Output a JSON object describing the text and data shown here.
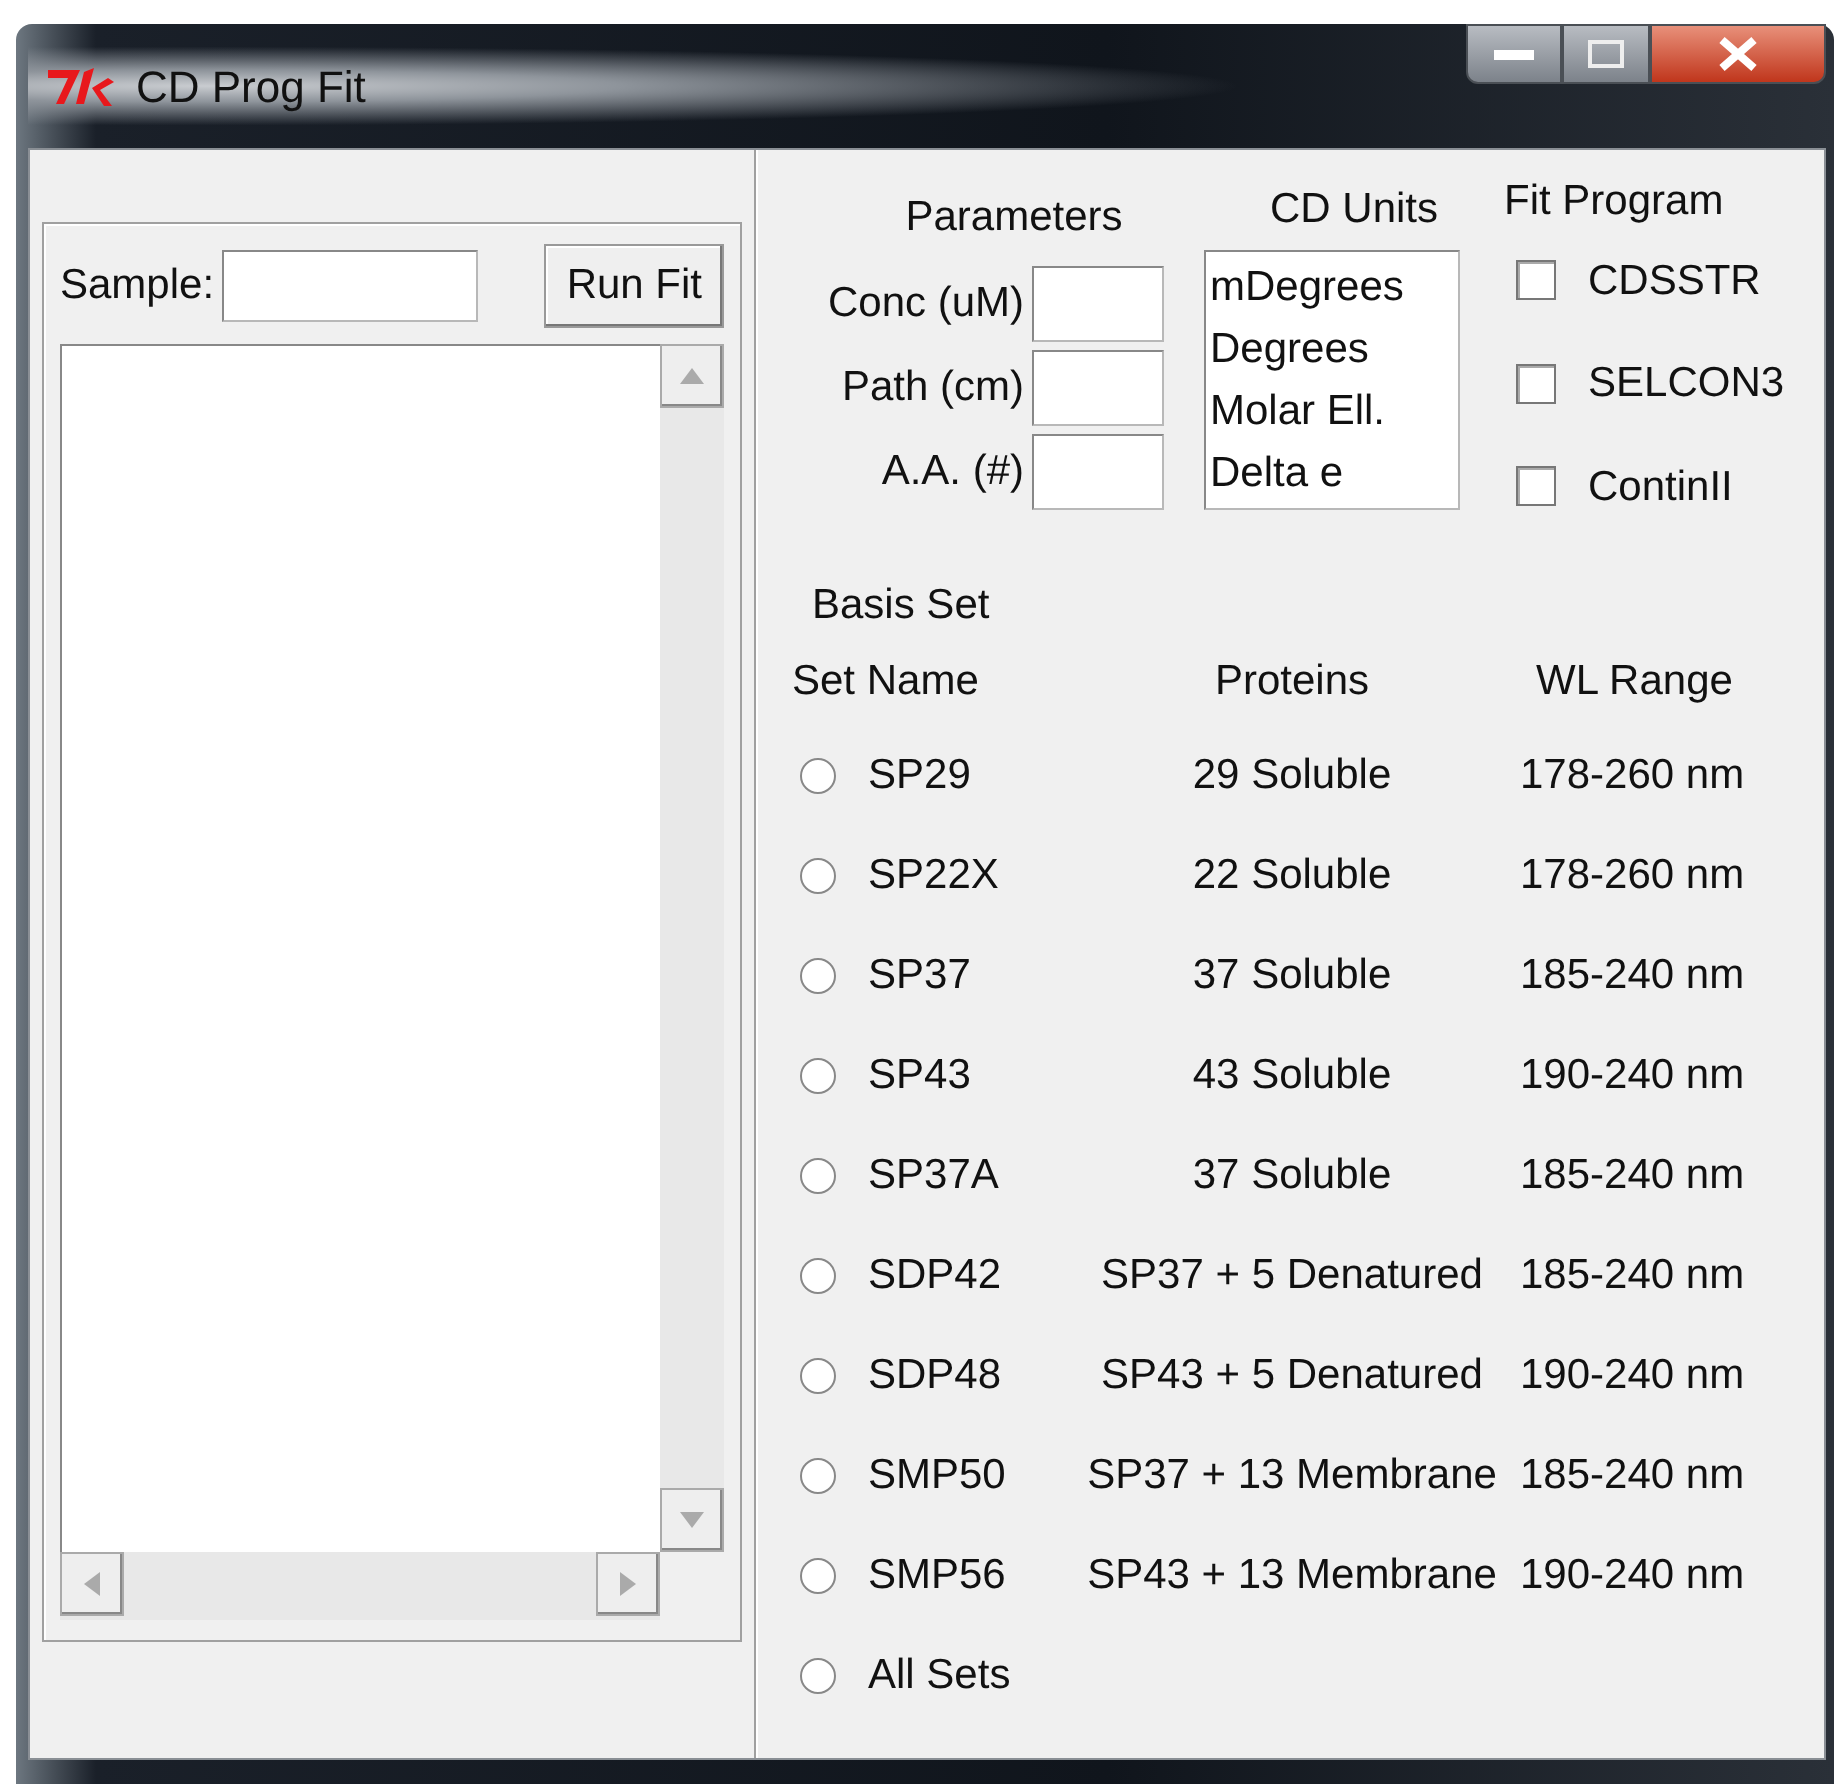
{
  "window": {
    "title": "CD Prog Fit"
  },
  "sample": {
    "label": "Sample:"
  },
  "run_button": "Run Fit",
  "parameters": {
    "title": "Parameters",
    "fields": [
      {
        "label": "Conc (uM)"
      },
      {
        "label": "Path (cm)"
      },
      {
        "label": "A.A. (#)"
      }
    ]
  },
  "cd_units": {
    "title": "CD Units",
    "options": [
      {
        "label": "mDegrees",
        "selected": false
      },
      {
        "label": "Degrees",
        "selected": false
      },
      {
        "label": "Molar Ell.",
        "selected": false
      },
      {
        "label": "Delta e",
        "selected": false
      }
    ]
  },
  "fit_program": {
    "title": "Fit Program",
    "options": [
      {
        "label": "CDSSTR",
        "checked": false
      },
      {
        "label": "SELCON3",
        "checked": false
      },
      {
        "label": "ContinII",
        "checked": false
      }
    ]
  },
  "basis_set": {
    "title": "Basis Set",
    "columns": [
      "Set Name",
      "Proteins",
      "WL Range"
    ],
    "rows": [
      {
        "name": "SP29",
        "proteins": "29 Soluble",
        "wl_range": "178-260 nm",
        "selected": false
      },
      {
        "name": "SP22X",
        "proteins": "22 Soluble",
        "wl_range": "178-260 nm",
        "selected": false
      },
      {
        "name": "SP37",
        "proteins": "37 Soluble",
        "wl_range": "185-240 nm",
        "selected": false
      },
      {
        "name": "SP43",
        "proteins": "43 Soluble",
        "wl_range": "190-240 nm",
        "selected": false
      },
      {
        "name": "SP37A",
        "proteins": "37 Soluble",
        "wl_range": "185-240 nm",
        "selected": false
      },
      {
        "name": "SDP42",
        "proteins": "SP37 + 5 Denatured",
        "wl_range": "185-240 nm",
        "selected": false
      },
      {
        "name": "SDP48",
        "proteins": "SP43 + 5 Denatured",
        "wl_range": "190-240 nm",
        "selected": false
      },
      {
        "name": "SMP50",
        "proteins": "SP37 + 13 Membrane",
        "wl_range": "185-240 nm",
        "selected": false
      },
      {
        "name": "SMP56",
        "proteins": "SP43 + 13 Membrane",
        "wl_range": "190-240 nm",
        "selected": false
      },
      {
        "name": "All Sets",
        "selected": false
      }
    ]
  }
}
